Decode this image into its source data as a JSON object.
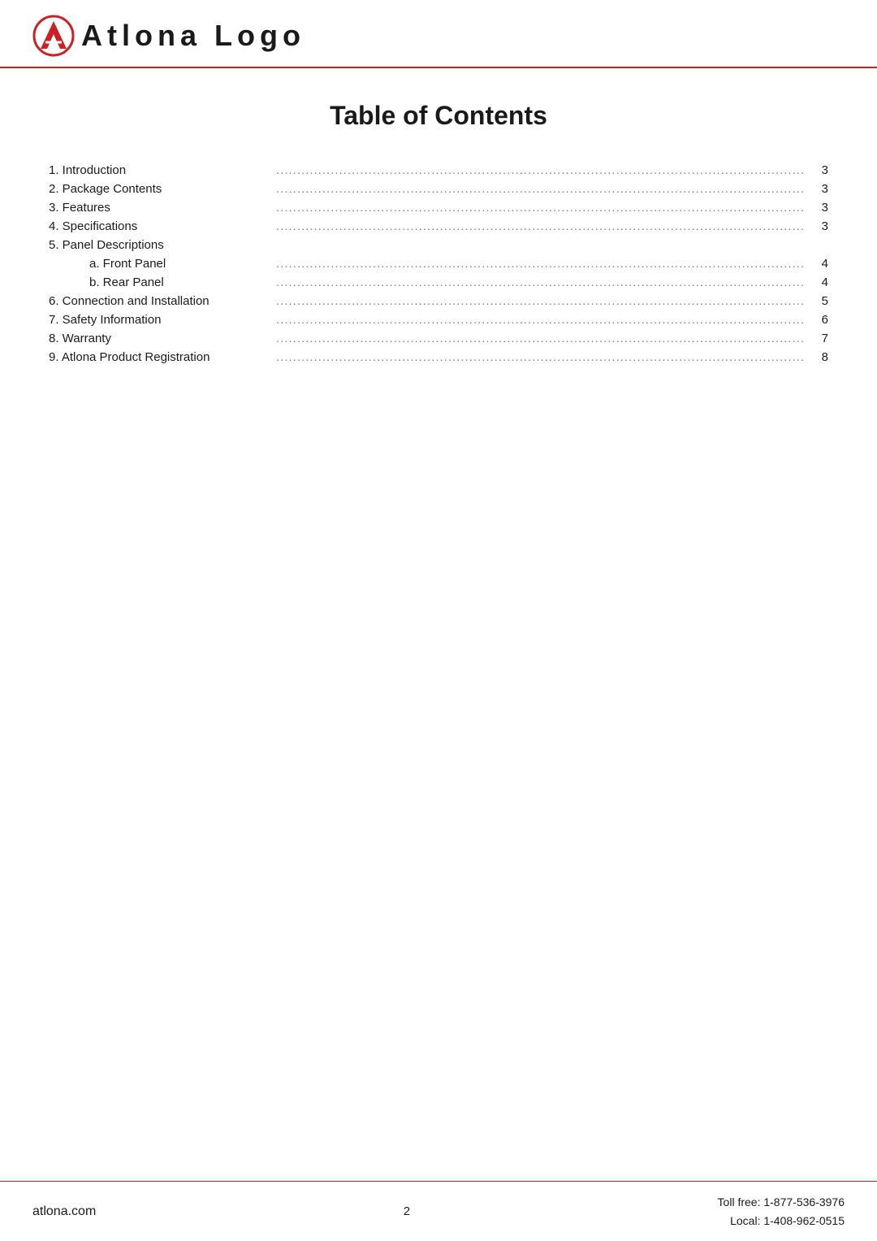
{
  "header": {
    "logo_alt": "Atlona Logo"
  },
  "page": {
    "title": "Table of Contents"
  },
  "toc": {
    "items": [
      {
        "number": "1.",
        "label": "Introduction",
        "dots": true,
        "page": "3",
        "indented": false
      },
      {
        "number": "2.",
        "label": "Package Contents",
        "dots": true,
        "page": "3",
        "indented": false
      },
      {
        "number": "3.",
        "label": "Features",
        "dots": true,
        "page": "3",
        "indented": false
      },
      {
        "number": "4.",
        "label": "Specifications",
        "dots": true,
        "page": "3",
        "indented": false
      },
      {
        "number": "5.",
        "label": "Panel Descriptions",
        "dots": false,
        "page": "",
        "indented": false
      },
      {
        "number": "a.",
        "label": "Front Panel",
        "dots": true,
        "page": "4",
        "indented": true
      },
      {
        "number": "b.",
        "label": "Rear Panel",
        "dots": true,
        "page": "4",
        "indented": true
      },
      {
        "number": "6.",
        "label": "Connection and Installation",
        "dots": true,
        "page": "5",
        "indented": false
      },
      {
        "number": "7.",
        "label": "Safety Information",
        "dots": true,
        "page": "6",
        "indented": false
      },
      {
        "number": "8.",
        "label": "Warranty",
        "dots": true,
        "page": "7",
        "indented": false
      },
      {
        "number": "9.",
        "label": "Atlona Product Registration",
        "dots": true,
        "page": "8",
        "indented": false
      }
    ]
  },
  "footer": {
    "website": "atlona.com",
    "page_number": "2",
    "toll_free": "Toll free: 1-877-536-3976",
    "local": "Local: 1-408-962-0515"
  }
}
